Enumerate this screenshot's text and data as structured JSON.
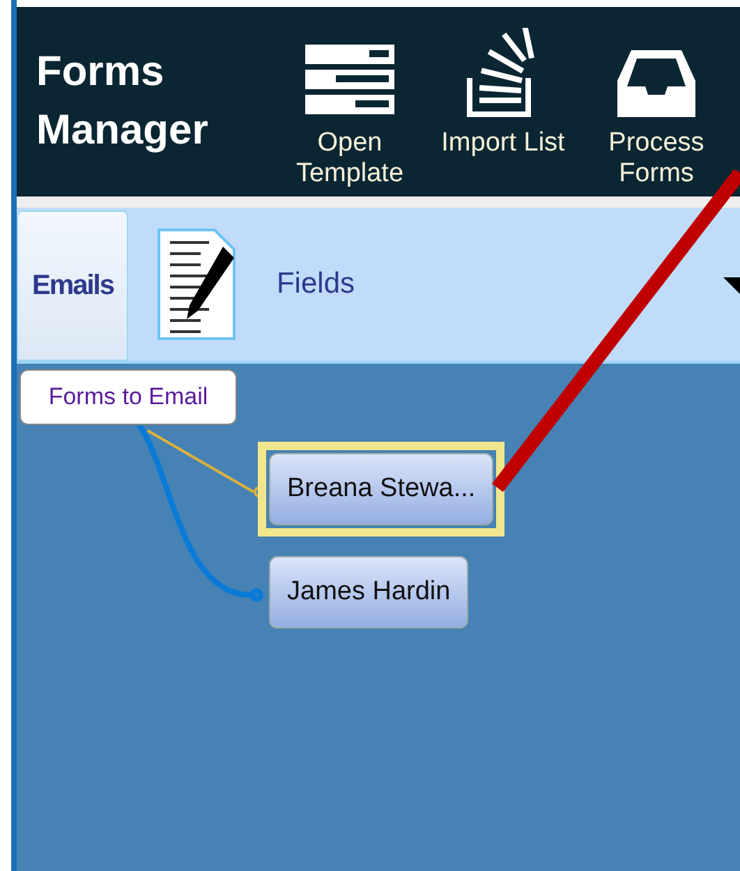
{
  "app": {
    "title": "Forms Manager"
  },
  "toolbar": [
    {
      "kind": "template",
      "label": "Open Template"
    },
    {
      "kind": "import",
      "label": "Import List"
    },
    {
      "kind": "inbox",
      "label": "Process Forms"
    }
  ],
  "tabs": [
    {
      "label": "Emails",
      "selected": true,
      "kind": "plain"
    },
    {
      "label": "Fields",
      "selected": false,
      "kind": "document"
    }
  ],
  "diagram": {
    "root": "Forms to Email",
    "nodes": [
      {
        "label": "Breana Stewa...",
        "selected": true
      },
      {
        "label": "James Hardin",
        "selected": false
      }
    ]
  }
}
